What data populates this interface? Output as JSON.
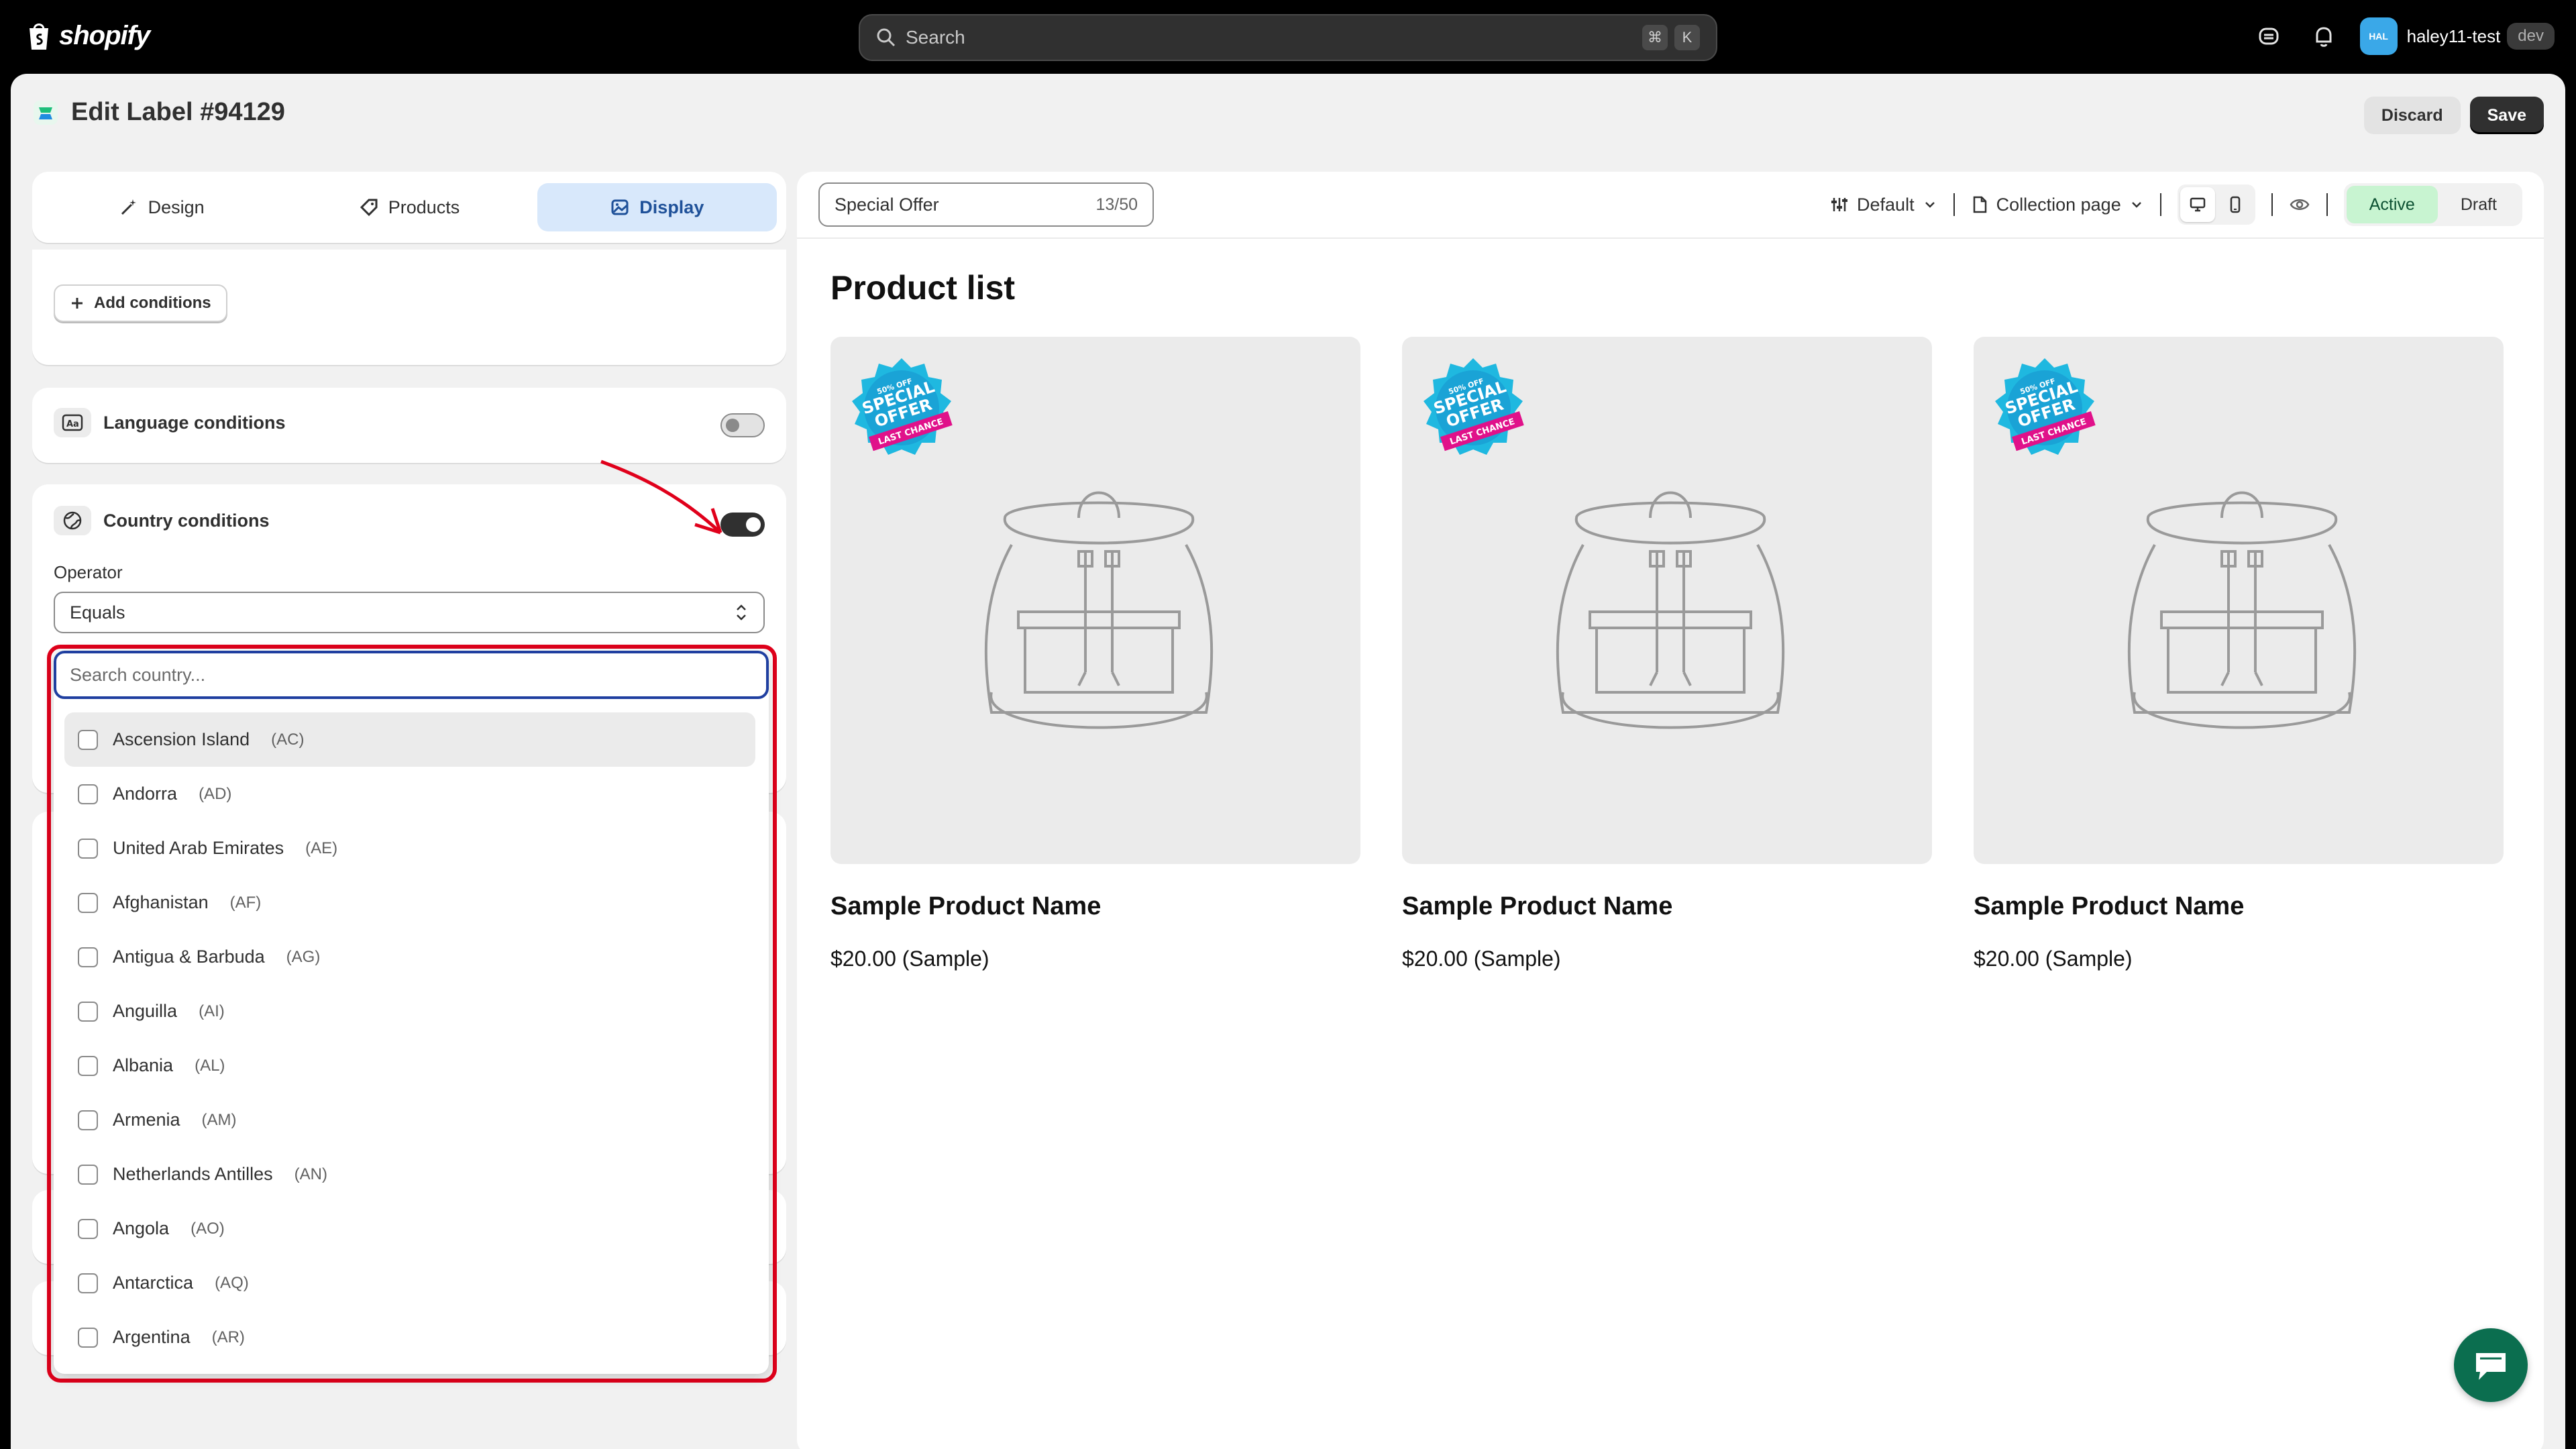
{
  "topbar": {
    "logo_text": "shopify",
    "search_placeholder": "Search",
    "shortcut_keys": [
      "⌘",
      "K"
    ],
    "avatar_initials": "HAL",
    "store_name": "haley11-test",
    "store_badge": "dev"
  },
  "header": {
    "title": "Edit Label #94129",
    "discard_label": "Discard",
    "save_label": "Save"
  },
  "tabs": [
    {
      "label": "Design",
      "active": false
    },
    {
      "label": "Products",
      "active": false
    },
    {
      "label": "Display",
      "active": true
    }
  ],
  "conditions": {
    "add_conditions_label": "Add conditions",
    "language": {
      "label": "Language conditions",
      "enabled": false
    },
    "country": {
      "label": "Country conditions",
      "enabled": true
    },
    "operator_label": "Operator",
    "operator_value": "Equals",
    "search_placeholder": "Search country...",
    "countries": [
      {
        "name": "Ascension Island",
        "code": "(AC)"
      },
      {
        "name": "Andorra",
        "code": "(AD)"
      },
      {
        "name": "United Arab Emirates",
        "code": "(AE)"
      },
      {
        "name": "Afghanistan",
        "code": "(AF)"
      },
      {
        "name": "Antigua & Barbuda",
        "code": "(AG)"
      },
      {
        "name": "Anguilla",
        "code": "(AI)"
      },
      {
        "name": "Albania",
        "code": "(AL)"
      },
      {
        "name": "Armenia",
        "code": "(AM)"
      },
      {
        "name": "Netherlands Antilles",
        "code": "(AN)"
      },
      {
        "name": "Angola",
        "code": "(AO)"
      },
      {
        "name": "Antarctica",
        "code": "(AQ)"
      },
      {
        "name": "Argentina",
        "code": "(AR)"
      }
    ]
  },
  "preview": {
    "label_name": "Special Offer",
    "label_count": "13/50",
    "template_label": "Default",
    "page_label": "Collection page",
    "status_active": "Active",
    "status_draft": "Draft",
    "list_title": "Product list",
    "badge_lines": [
      "50% OFF",
      "SPECIAL",
      "OFFER",
      "LAST CHANCE"
    ],
    "products": [
      {
        "name": "Sample Product Name",
        "price": "$20.00 (Sample)"
      },
      {
        "name": "Sample Product Name",
        "price": "$20.00 (Sample)"
      },
      {
        "name": "Sample Product Name",
        "price": "$20.00 (Sample)"
      }
    ]
  },
  "colors": {
    "accent_blue": "#1f5199",
    "active_green": "#c8f4d1",
    "highlight_red": "#e0001b",
    "badge_cyan": "#1fb8e0",
    "badge_pink": "#e0118a"
  }
}
